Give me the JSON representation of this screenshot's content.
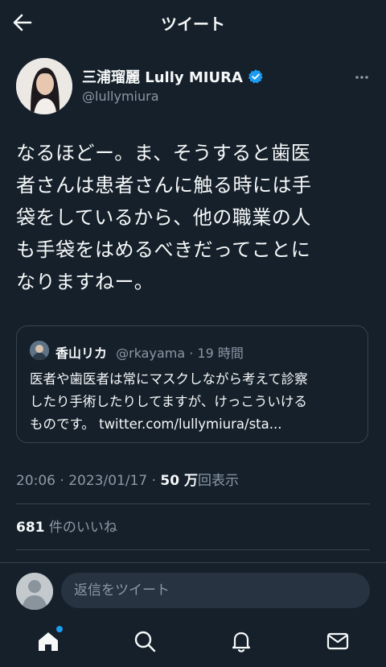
{
  "header": {
    "title": "ツイート"
  },
  "author": {
    "name": "三浦瑠麗 Lully MIURA",
    "handle": "@lullymiura",
    "verified": true
  },
  "tweet": {
    "lines": [
      "なるほどー。ま、そうすると歯医",
      "者さんは患者さんに触る時には手",
      "袋をしているから、他の職業の人",
      "も手袋をはめるべきだってことに",
      "なりますねー。"
    ]
  },
  "quote": {
    "name": "香山リカ",
    "meta": "@rkayama · 19 時間",
    "lines": [
      "医者や歯医者は常にマスクしながら考えて診察",
      "したり手術したりしてますが、けっこういける",
      "ものです。 twitter.com/lullymiura/sta..."
    ]
  },
  "stats": {
    "time": "20:06 · 2023/01/17 · ",
    "views_value": "50 万",
    "views_label": "回表示",
    "likes_value": "681",
    "likes_label": " 件のいいね"
  },
  "reply": {
    "placeholder": "返信をツイート"
  },
  "colors": {
    "background": "#15202b",
    "accent": "#1d9bf0",
    "muted": "#8b98a5",
    "border": "#38444d"
  },
  "icons": [
    "back-arrow-icon",
    "verified-badge-icon",
    "more-icon",
    "home-icon",
    "search-icon",
    "notifications-icon",
    "messages-icon"
  ]
}
